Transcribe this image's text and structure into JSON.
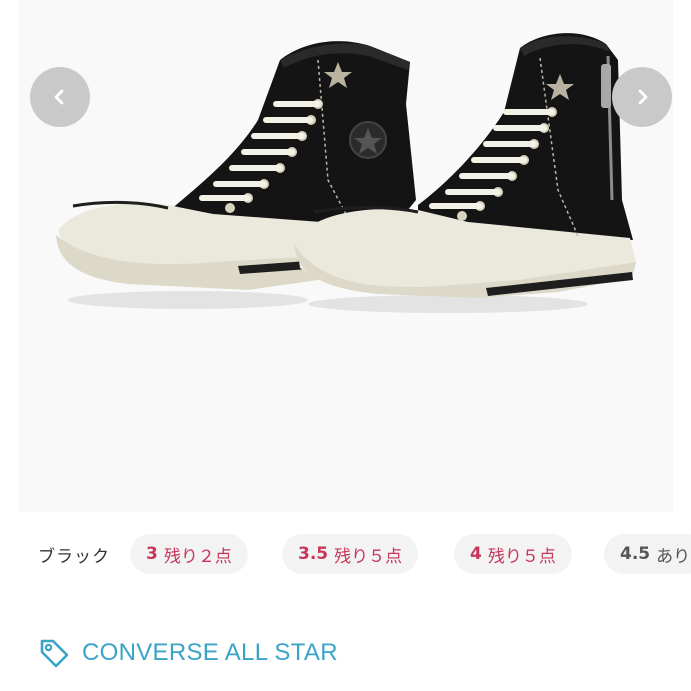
{
  "gallery": {
    "image_alt": "Converse All Star high-top sneakers, black with side zip",
    "prev_icon": "chevron-left-icon",
    "next_icon": "chevron-right-icon"
  },
  "variants": {
    "color_label": "ブラック",
    "sizes": [
      {
        "size": "3",
        "stock": "残り２点",
        "color": "#c7365a"
      },
      {
        "size": "3.5",
        "stock": "残り５点",
        "color": "#c7365a"
      },
      {
        "size": "4",
        "stock": "残り５点",
        "color": "#c7365a"
      },
      {
        "size": "4.5",
        "stock": "あり",
        "color": "#555555"
      }
    ]
  },
  "brand": {
    "icon": "tag-icon",
    "name": "CONVERSE ALL STAR",
    "color": "#3aa3c6"
  }
}
